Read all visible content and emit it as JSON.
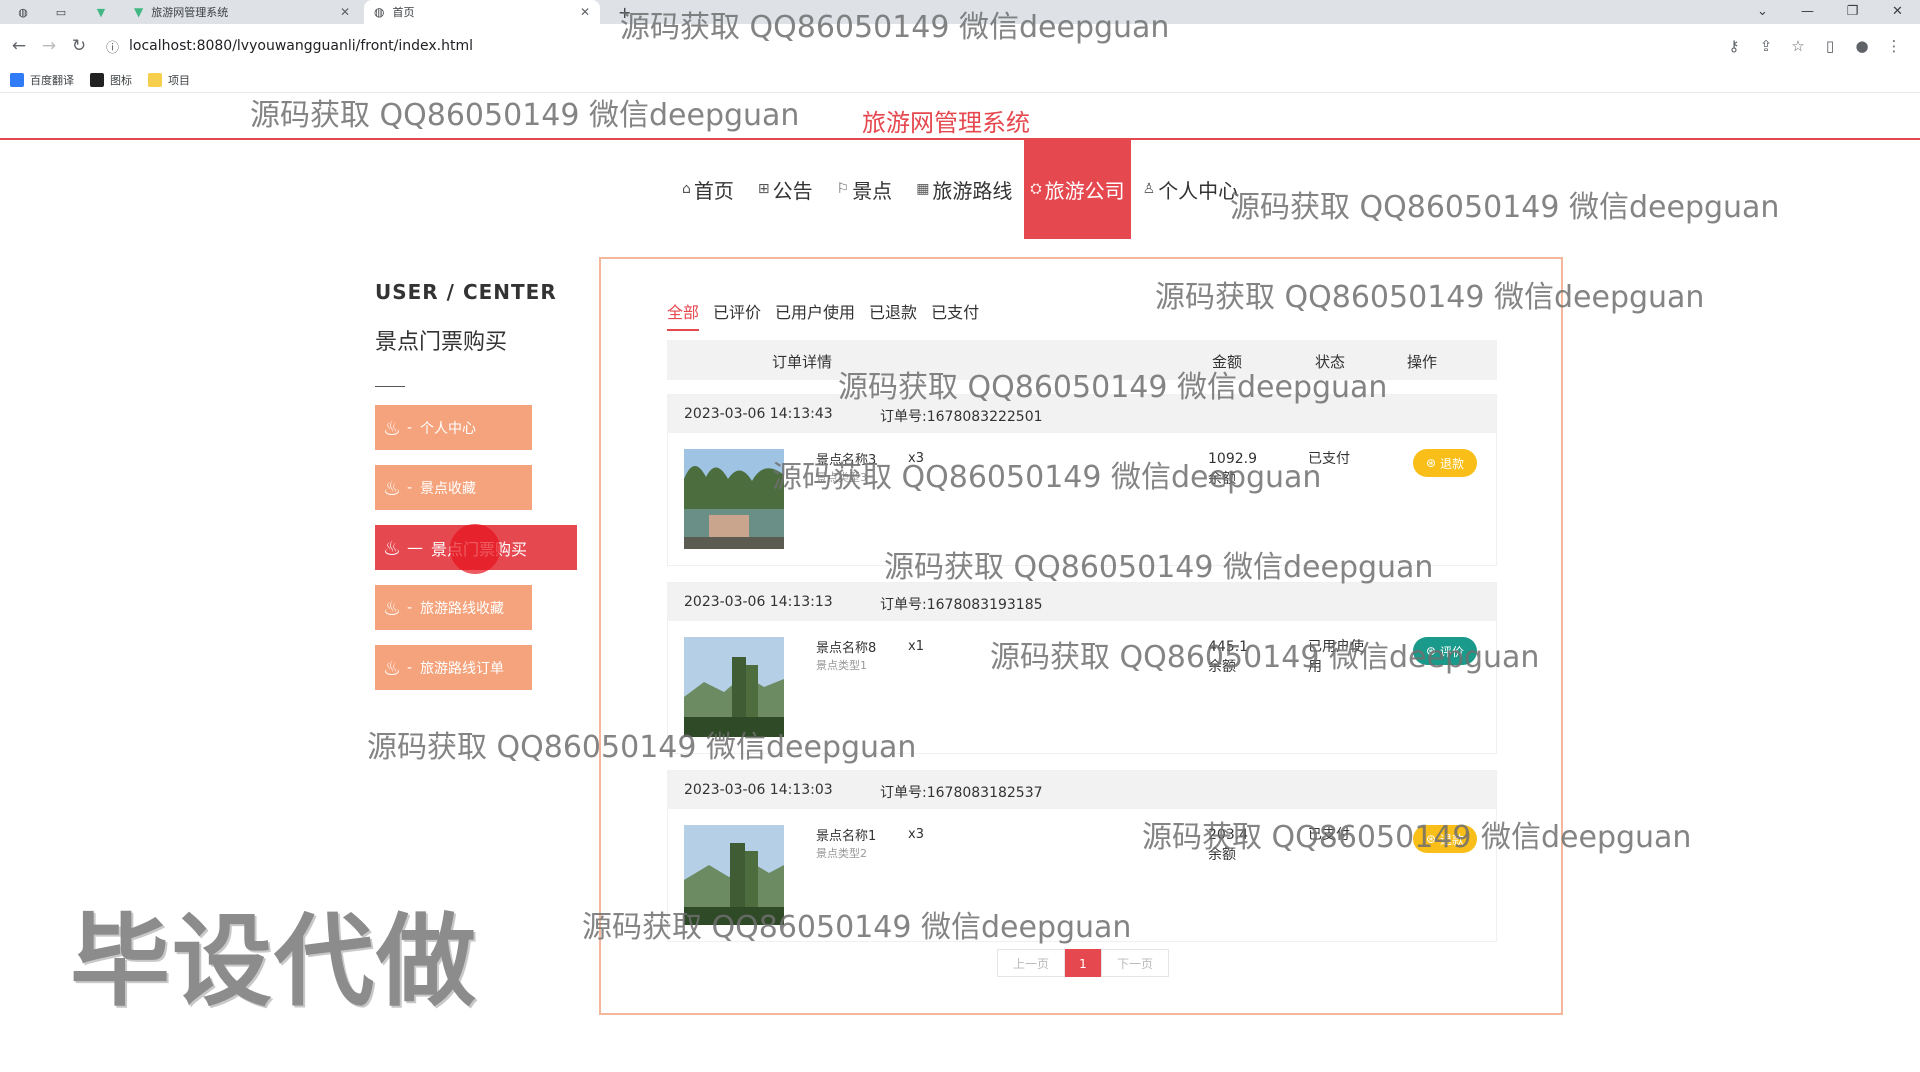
{
  "browser": {
    "tabs": [
      {
        "title": "旅游网管理系统"
      },
      {
        "title": "首页"
      }
    ],
    "new_tab": "+",
    "url": "localhost:8080/lvyouwangguanli/front/index.html",
    "bookmarks": [
      "百度翻译",
      "图标",
      "项目"
    ]
  },
  "site": {
    "title": "旅游网管理系统",
    "nav": [
      {
        "label": "首页",
        "icon": "home-icon"
      },
      {
        "label": "公告",
        "icon": "notice-icon"
      },
      {
        "label": "景点",
        "icon": "flag-icon"
      },
      {
        "label": "旅游路线",
        "icon": "grid-icon"
      },
      {
        "label": "旅游公司",
        "icon": "company-icon",
        "active": true
      },
      {
        "label": "个人中心",
        "icon": "user-icon"
      }
    ]
  },
  "sidebar": {
    "title": "USER / CENTER",
    "subtitle": "景点门票购买",
    "items": [
      {
        "label": "个人中心"
      },
      {
        "label": "景点收藏"
      },
      {
        "label": "景点门票购买",
        "active": true
      },
      {
        "label": "旅游路线收藏"
      },
      {
        "label": "旅游路线订单"
      }
    ]
  },
  "orders": {
    "tabs": [
      "全部",
      "已评价",
      "已用户使用",
      "已退款",
      "已支付"
    ],
    "active_tab": "全部",
    "columns": {
      "detail": "订单详情",
      "amount": "金额",
      "status": "状态",
      "action": "操作"
    },
    "order_no_prefix": "订单号:",
    "rows": [
      {
        "time": "2023-03-06 14:13:43",
        "order_no": "订单号:1678083222501",
        "name": "景点名称3",
        "type": "景点类型3",
        "qty": "x3",
        "amount": "1092.9",
        "pay": "余额",
        "status": "已支付",
        "action": "退款",
        "action_color": "#f9be17"
      },
      {
        "time": "2023-03-06 14:13:13",
        "order_no": "订单号:1678083193185",
        "name": "景点名称8",
        "type": "景点类型1",
        "qty": "x1",
        "amount": "445.1",
        "pay": "余额",
        "status": "已用户使用",
        "action": "评价",
        "action_color": "#1a9a8a"
      },
      {
        "time": "2023-03-06 14:13:03",
        "order_no": "订单号:1678083182537",
        "name": "景点名称1",
        "type": "景点类型2",
        "qty": "x3",
        "amount": "203.4",
        "pay": "余额",
        "status": "已支付",
        "action": "退款",
        "action_color": "#f9be17"
      }
    ],
    "pager": {
      "prev": "上一页",
      "current": "1",
      "next": "下一页"
    }
  },
  "watermarks": {
    "text": "源码获取 QQ86050149 微信deepguan",
    "big": "毕设代做"
  }
}
